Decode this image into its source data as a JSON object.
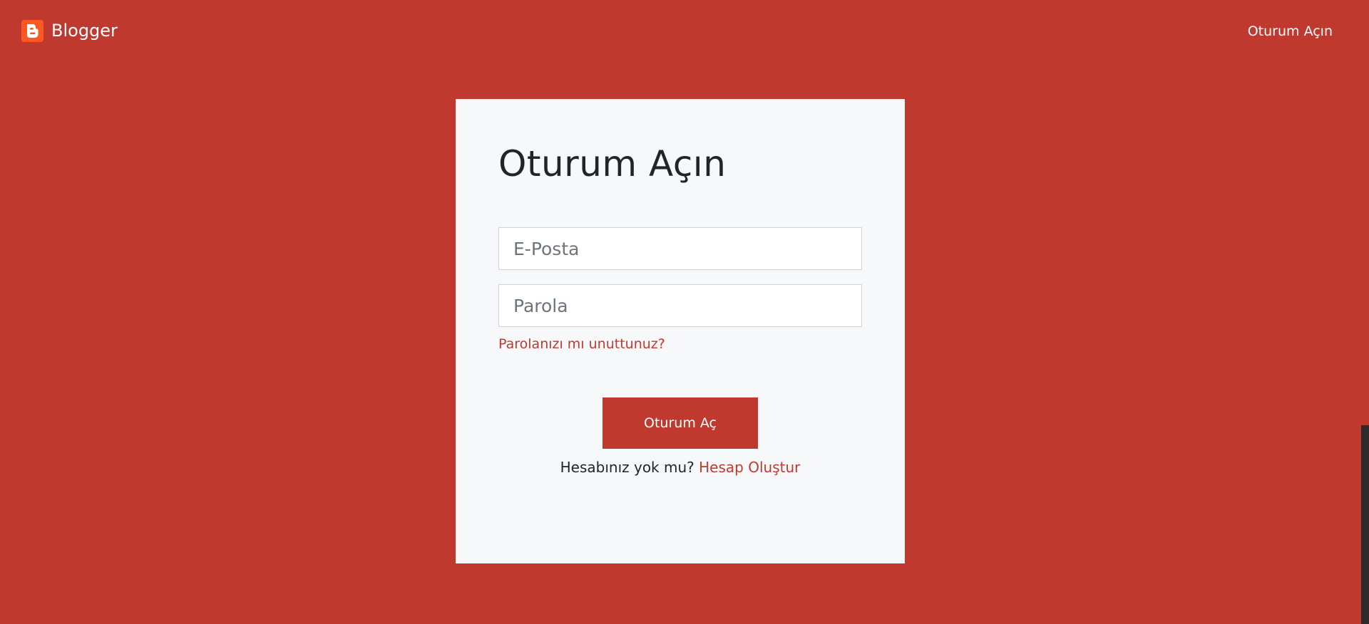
{
  "navbar": {
    "brand_name": "Blogger",
    "brand_logo_icon": "blogger-logo-icon",
    "signin_link": "Oturum Açın"
  },
  "login_card": {
    "title": "Oturum Açın",
    "email_placeholder": "E-Posta",
    "email_value": "",
    "password_placeholder": "Parola",
    "password_value": "",
    "forgot_password": "Parolanızı mı unuttunuz?",
    "submit_label": "Oturum Aç",
    "no_account_text": "Hesabınız yok mu?",
    "create_account_link": "Hesap Oluştur"
  },
  "colors": {
    "background": "#c0392f",
    "card_background": "#f7f8fa",
    "accent": "#c0392f",
    "logo": "#ff5722",
    "text_dark": "#212529"
  }
}
